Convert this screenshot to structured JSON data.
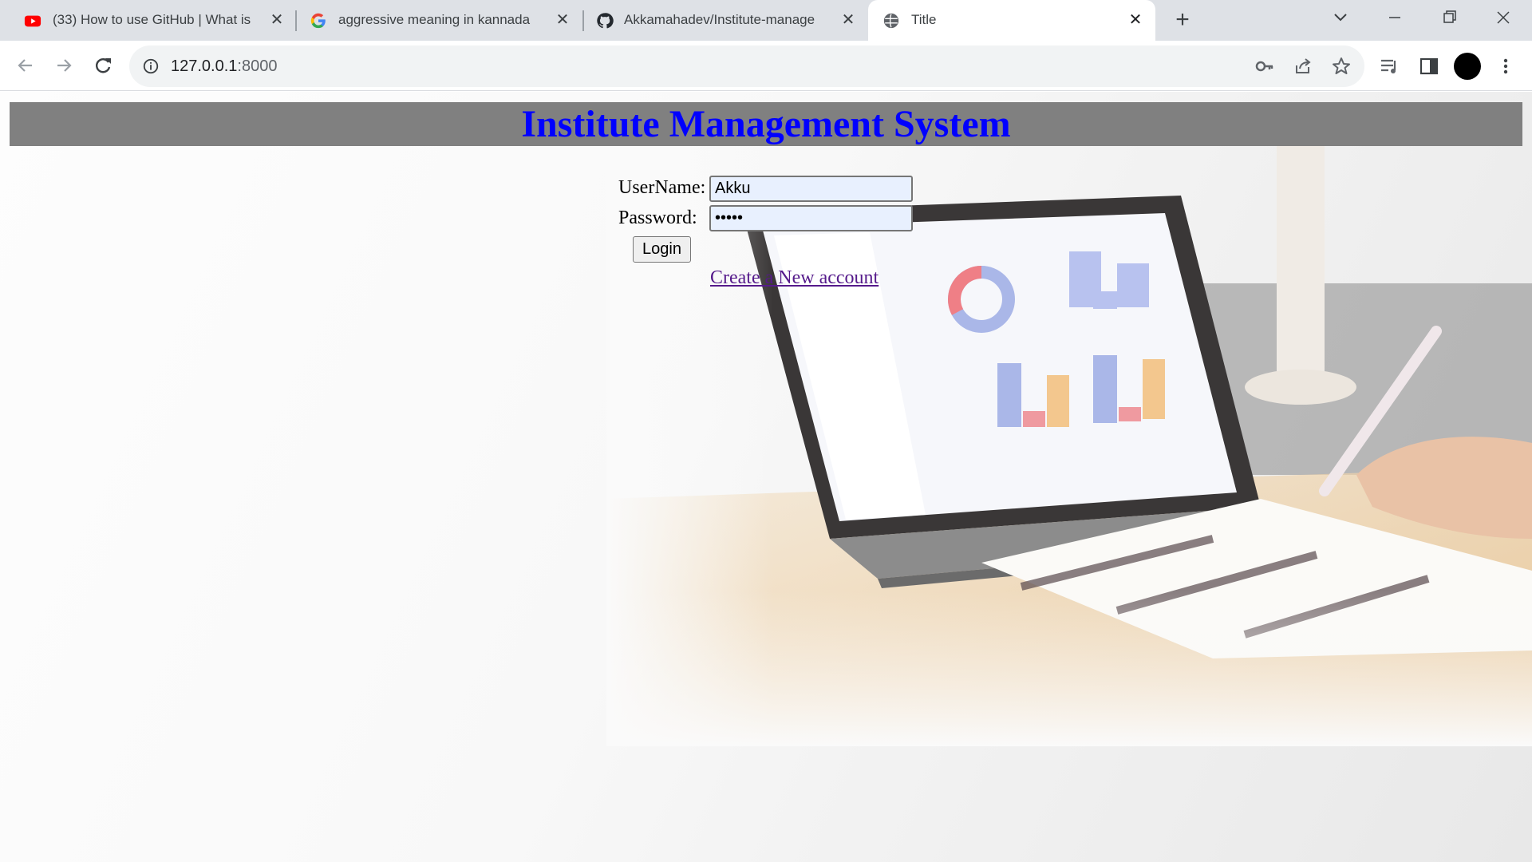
{
  "browser": {
    "tabs": [
      {
        "title": "(33) How to use GitHub | What is",
        "icon": "youtube-icon"
      },
      {
        "title": "aggressive meaning in kannada",
        "icon": "google-icon"
      },
      {
        "title": "Akkamahadev/Institute-manage",
        "icon": "github-icon"
      },
      {
        "title": "Title",
        "icon": "globe-icon"
      }
    ],
    "address": {
      "host": "127.0.0.1",
      "port": ":8000"
    }
  },
  "page": {
    "title": "Institute Management System",
    "form": {
      "username_label": "UserName:",
      "username_value": "Akku",
      "password_label": "Password:",
      "password_value": "•••••",
      "login_label": "Login",
      "create_account_label": "Create a New account"
    }
  },
  "colors": {
    "title": "#0000ff",
    "header_bg": "#808080",
    "link": "#551a8b"
  }
}
